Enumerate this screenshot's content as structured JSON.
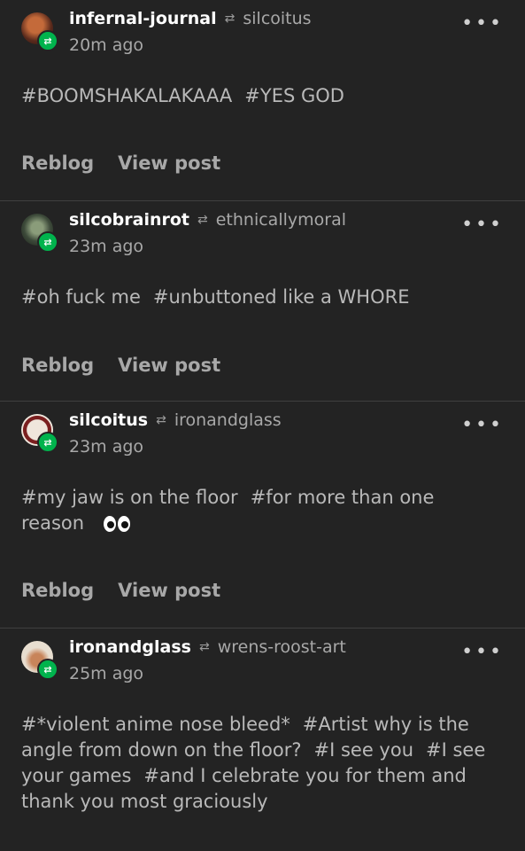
{
  "posts": [
    {
      "username": "infernal-journal",
      "source": "silcoitus",
      "time": "20m ago",
      "tags": [
        "#BOOMSHAKALAKAAA",
        "#YES GOD"
      ],
      "reblog_label": "Reblog",
      "view_label": "View post",
      "avatar_color": "#5a2a1c"
    },
    {
      "username": "silcobrainrot",
      "source": "ethnicallymoral",
      "time": "23m ago",
      "tags": [
        "#oh fuck me",
        "#unbuttoned like a WHORE"
      ],
      "reblog_label": "Reblog",
      "view_label": "View post",
      "avatar_color": "#3d4a3a"
    },
    {
      "username": "silcoitus",
      "source": "ironandglass",
      "time": "23m ago",
      "tags": [
        "#my jaw is on the floor",
        "#for more than one reason"
      ],
      "reblog_label": "Reblog",
      "view_label": "View post",
      "avatar_color": "#7a1f1f"
    },
    {
      "username": "ironandglass",
      "source": "wrens-roost-art",
      "time": "25m ago",
      "tags": [
        "#*violent anime nose bleed*",
        "#Artist why is the angle from down on the floor?",
        "#I see you",
        "#I see your games",
        "#and I celebrate you for them and thank you most graciously"
      ],
      "avatar_color": "#e8ded0"
    }
  ],
  "icons": {
    "more": "more-icon",
    "reblog": "reblog-icon",
    "eyes": "eyes-emoji"
  },
  "colors": {
    "background": "#232323",
    "badge": "#00b34d"
  }
}
